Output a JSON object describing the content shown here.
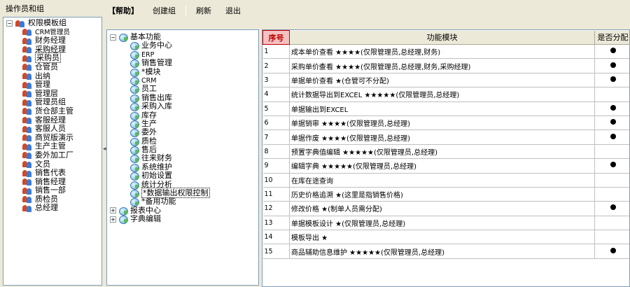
{
  "left_header": "操作员和组",
  "toolbar": {
    "help": "【帮助】",
    "create_group": "创建组",
    "refresh": "刷新",
    "exit": "退出"
  },
  "left_tree": {
    "root": "权限模板组",
    "items": [
      "CRM管理员",
      "财务经理",
      "采购经理",
      "采购员",
      "仓管员",
      "出纳",
      "管理",
      "管理层",
      "管理员组",
      "货仓部主管",
      "客服经理",
      "客服人员",
      "商贸版演示",
      "生产主管",
      "委外加工厂",
      "文员",
      "销售代表",
      "销售经理",
      "销售一部",
      "质检员",
      "总经理"
    ],
    "selected": "采购员"
  },
  "module_tree": {
    "root": "基本功能",
    "children": [
      "业务中心",
      "ERP",
      "销售管理",
      "*模块",
      "CRM",
      "员工",
      "销售出库",
      "采购入库",
      "库存",
      "生产",
      "委外",
      "质检",
      "售后",
      "往来财务",
      "系统维护",
      "初始设置",
      "统计分析",
      "*数据输出权限控制",
      "*备用功能"
    ],
    "selected": "*数据输出权限控制",
    "other_roots": [
      "报表中心",
      "字典编辑"
    ]
  },
  "grid": {
    "headers": [
      "序号",
      "功能模块",
      "是否分配"
    ],
    "rows": [
      {
        "seq": "1",
        "module": "成本单价查看  ★★★★(仅限管理员,总经理,财务)",
        "assigned": true
      },
      {
        "seq": "2",
        "module": "采购单价查看  ★★★★(仅限管理员,总经理,财务,采购经理)",
        "assigned": true
      },
      {
        "seq": "3",
        "module": "单据单价查看  ★(仓管可不分配)",
        "assigned": true
      },
      {
        "seq": "4",
        "module": "统计数据导出到EXCEL  ★★★★★(仅限管理员,总经理)",
        "assigned": false
      },
      {
        "seq": "5",
        "module": "单据输出到EXCEL",
        "assigned": true
      },
      {
        "seq": "6",
        "module": "单据销审  ★★★★(仅限管理员,总经理)",
        "assigned": true
      },
      {
        "seq": "7",
        "module": "单据作废  ★★★★(仅限管理员,总经理)",
        "assigned": true
      },
      {
        "seq": "8",
        "module": "预置字典值编辑  ★★★★★(仅限管理员,总经理)",
        "assigned": false
      },
      {
        "seq": "9",
        "module": "编辑字典  ★★★★★(仅限管理员,总经理)",
        "assigned": true
      },
      {
        "seq": "10",
        "module": "在库在途查询",
        "assigned": false
      },
      {
        "seq": "11",
        "module": "历史价格追溯  ★(这里是指销售价格)",
        "assigned": false
      },
      {
        "seq": "12",
        "module": "修改价格  ★(制单人员需分配)",
        "assigned": true
      },
      {
        "seq": "13",
        "module": "单据模板设计  ★(仅限管理员,总经理)",
        "assigned": false
      },
      {
        "seq": "14",
        "module": "模板导出  ★",
        "assigned": false
      },
      {
        "seq": "15",
        "module": "商品辅助信息维护  ★★★★★(仅限管理员,总经理)",
        "assigned": true
      }
    ]
  }
}
